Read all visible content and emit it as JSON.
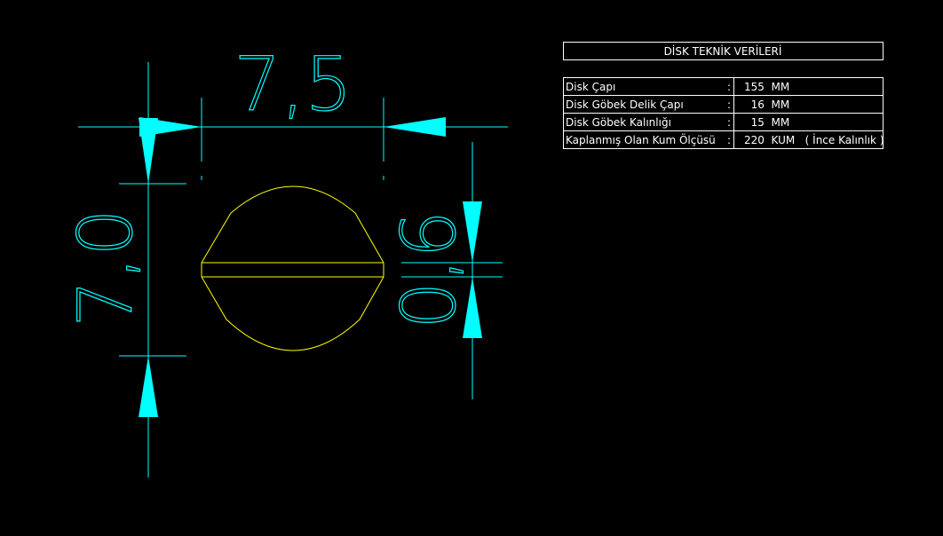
{
  "colors": {
    "background": "#000000",
    "dimension": "#00ffff",
    "part": "#ffff00",
    "table_border": "#ffffff",
    "table_text": "#ffffff"
  },
  "drawing": {
    "width_dimension": "7,5",
    "height_dimension": "7,0",
    "right_dimension": "0,6"
  },
  "table": {
    "title": "DİSK TEKNİK VERİLERİ",
    "rows": [
      {
        "label": "Disk Çapı",
        "sep": ":",
        "value": "155  MM"
      },
      {
        "label": "Disk Göbek Delik Çapı",
        "sep": ":",
        "value": "  16  MM"
      },
      {
        "label": "Disk Göbek Kalınlığı",
        "sep": ":",
        "value": "  15  MM"
      },
      {
        "label": "Kaplanmış Olan Kum Ölçüsü",
        "sep": ":",
        "value": "220  KUM   ( İnce Kalınlık )"
      }
    ]
  }
}
